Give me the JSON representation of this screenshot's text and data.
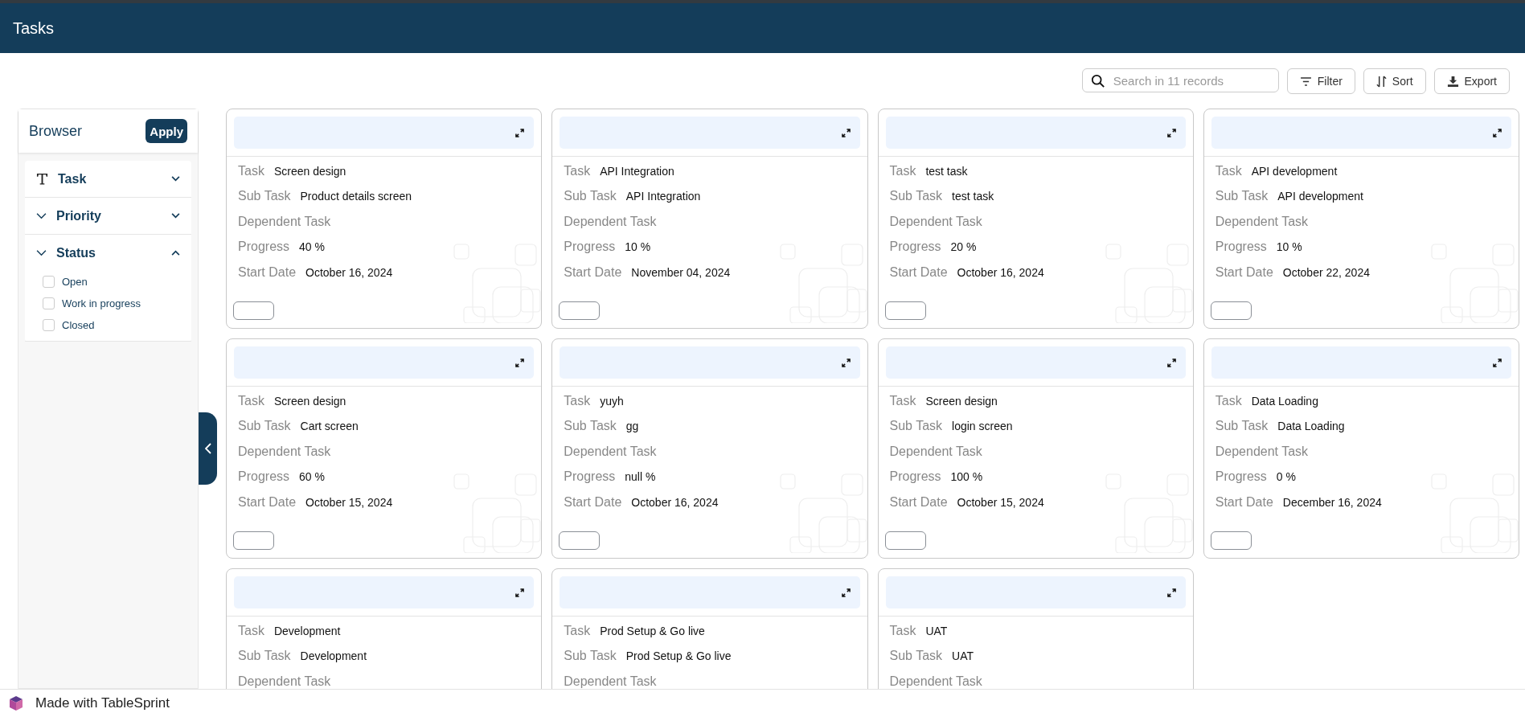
{
  "header": {
    "title": "Tasks"
  },
  "toolbar": {
    "search": {
      "placeholder": "Search in 11 records"
    },
    "buttons": [
      {
        "label": "Filter",
        "kind": "filter"
      },
      {
        "label": "Sort",
        "kind": "sort"
      },
      {
        "label": "Export",
        "kind": "export"
      }
    ]
  },
  "browser": {
    "title": "Browser",
    "apply": "Apply",
    "sections": [
      {
        "label": "Task",
        "kind": "text",
        "expanded": false
      },
      {
        "label": "Priority",
        "kind": "choice",
        "expanded": false
      },
      {
        "label": "Status",
        "kind": "choice",
        "expanded": true,
        "options": [
          {
            "label": "Open",
            "checked": false
          },
          {
            "label": "Work in progress",
            "checked": false
          },
          {
            "label": "Closed",
            "checked": false
          }
        ]
      }
    ]
  },
  "cards": [
    {
      "fields": [
        {
          "label": "Task",
          "value": "Screen design"
        },
        {
          "label": "Sub Task",
          "value": "Product details screen"
        },
        {
          "label": "Dependent Task"
        },
        {
          "label": "Progress",
          "value": "40 %"
        },
        {
          "label": "Start Date",
          "value": "October 16, 2024"
        }
      ]
    },
    {
      "fields": [
        {
          "label": "Task",
          "value": "API Integration"
        },
        {
          "label": "Sub Task",
          "value": "API Integration"
        },
        {
          "label": "Dependent Task"
        },
        {
          "label": "Progress",
          "value": "10 %"
        },
        {
          "label": "Start Date",
          "value": "November 04, 2024"
        }
      ]
    },
    {
      "fields": [
        {
          "label": "Task",
          "value": "test task"
        },
        {
          "label": "Sub Task",
          "value": "test task"
        },
        {
          "label": "Dependent Task"
        },
        {
          "label": "Progress",
          "value": "20 %"
        },
        {
          "label": "Start Date",
          "value": "October 16, 2024"
        }
      ]
    },
    {
      "fields": [
        {
          "label": "Task",
          "value": "API development"
        },
        {
          "label": "Sub Task",
          "value": "API development"
        },
        {
          "label": "Dependent Task"
        },
        {
          "label": "Progress",
          "value": "10 %"
        },
        {
          "label": "Start Date",
          "value": "October 22, 2024"
        }
      ]
    },
    {
      "fields": [
        {
          "label": "Task",
          "value": "Screen design"
        },
        {
          "label": "Sub Task",
          "value": "Cart screen"
        },
        {
          "label": "Dependent Task"
        },
        {
          "label": "Progress",
          "value": "60 %"
        },
        {
          "label": "Start Date",
          "value": "October 15, 2024"
        }
      ]
    },
    {
      "fields": [
        {
          "label": "Task",
          "value": "yuyh"
        },
        {
          "label": "Sub Task",
          "value": "gg"
        },
        {
          "label": "Dependent Task"
        },
        {
          "label": "Progress",
          "value": "null %"
        },
        {
          "label": "Start Date",
          "value": "October 16, 2024"
        }
      ]
    },
    {
      "fields": [
        {
          "label": "Task",
          "value": "Screen design"
        },
        {
          "label": "Sub Task",
          "value": "login screen"
        },
        {
          "label": "Dependent Task"
        },
        {
          "label": "Progress",
          "value": "100 %"
        },
        {
          "label": "Start Date",
          "value": "October 15, 2024"
        }
      ]
    },
    {
      "fields": [
        {
          "label": "Task",
          "value": "Data Loading"
        },
        {
          "label": "Sub Task",
          "value": "Data Loading"
        },
        {
          "label": "Dependent Task"
        },
        {
          "label": "Progress",
          "value": "0 %"
        },
        {
          "label": "Start Date",
          "value": "December 16, 2024"
        }
      ]
    },
    {
      "fields": [
        {
          "label": "Task",
          "value": "Development"
        },
        {
          "label": "Sub Task",
          "value": "Development"
        },
        {
          "label": "Dependent Task"
        }
      ]
    },
    {
      "fields": [
        {
          "label": "Task",
          "value": "Prod Setup & Go live"
        },
        {
          "label": "Sub Task",
          "value": "Prod Setup & Go live"
        },
        {
          "label": "Dependent Task"
        }
      ]
    },
    {
      "fields": [
        {
          "label": "Task",
          "value": "UAT"
        },
        {
          "label": "Sub Task",
          "value": "UAT"
        },
        {
          "label": "Dependent Task"
        }
      ]
    }
  ],
  "footer": {
    "text": "Made with TableSprint"
  }
}
